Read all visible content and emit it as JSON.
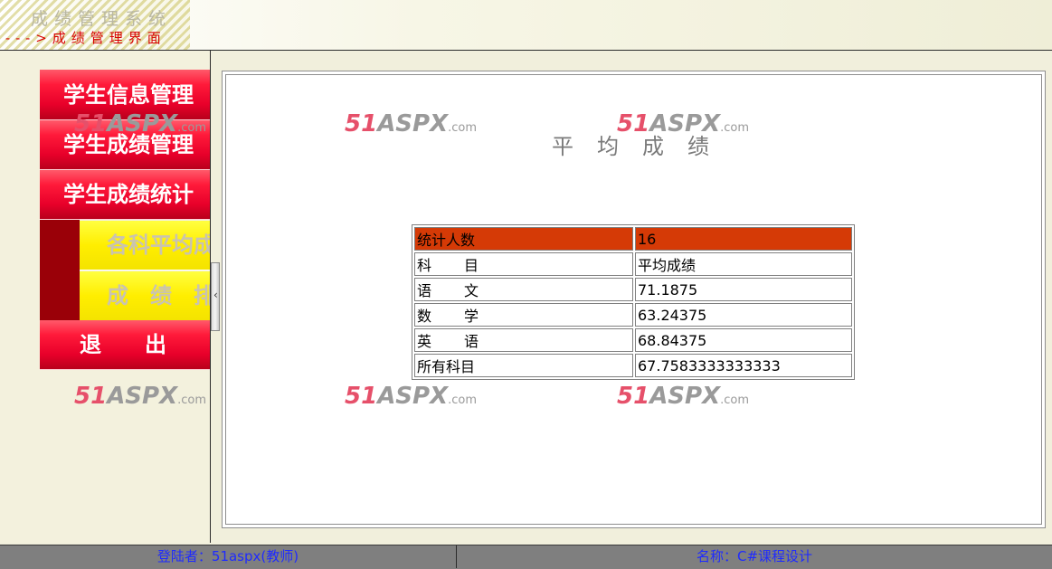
{
  "header": {
    "system_title": "成绩管理系统",
    "subtitle": "--->成绩管理界面"
  },
  "sidebar": {
    "items": [
      {
        "label": "学生信息管理"
      },
      {
        "label": "学生成绩管理"
      },
      {
        "label": "学生成绩统计"
      },
      {
        "label": "退　　出"
      }
    ],
    "sub_items": [
      {
        "label": "各科平均成绩"
      },
      {
        "label": "成　绩　排　名"
      }
    ]
  },
  "watermark": {
    "n": "51",
    "a": "ASPX",
    "c": ".com"
  },
  "main": {
    "title": "平均成绩",
    "stats": {
      "count_label": "统计人数",
      "count_value": "16",
      "header_subject": "科目",
      "header_average": "平均成绩",
      "rows": [
        {
          "subject": "语文",
          "average": "71.1875"
        },
        {
          "subject": "数学",
          "average": "63.24375"
        },
        {
          "subject": "英语",
          "average": "68.84375"
        },
        {
          "subject": "所有科目",
          "average": "67.7583333333333"
        }
      ]
    }
  },
  "status": {
    "login_label": "登陆者：",
    "login_user": "51aspx(教师)",
    "name_label": "名称：",
    "name_value": "C#课程设计"
  },
  "colors": {
    "menu_red": "#e8002a",
    "submenu_yellow": "#ffee00",
    "table_header": "#d53a06",
    "status_text": "#1f2bff"
  }
}
